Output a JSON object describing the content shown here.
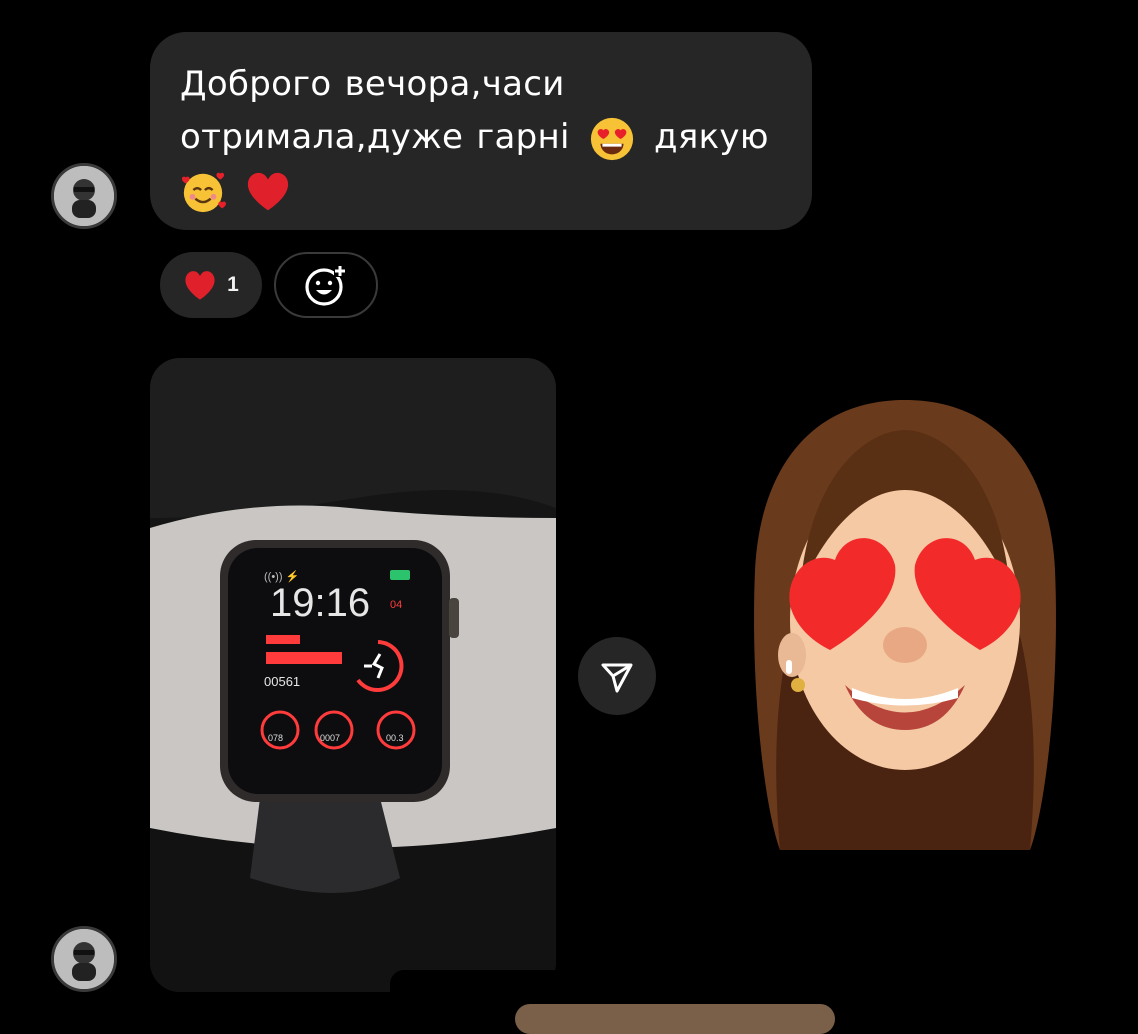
{
  "message": {
    "line1": "Доброго вечора,часи",
    "line2_a": "отримала,дуже гарні",
    "line2_b": "дякую"
  },
  "reaction": {
    "emoji": "heart-icon",
    "count": "1"
  },
  "add_reaction": {
    "icon": "add-reaction-icon"
  },
  "photo": {
    "watch_time": "19:16",
    "watch_date": "04",
    "watch_steps": "00561",
    "watch_stat1": "078",
    "watch_stat2": "0007",
    "watch_stat3": "00.3"
  },
  "share": {
    "icon": "send-icon"
  },
  "colors": {
    "background": "#000000",
    "bubble": "#262626",
    "heart": "#e0202a",
    "accent_red": "#ff3b3b"
  }
}
